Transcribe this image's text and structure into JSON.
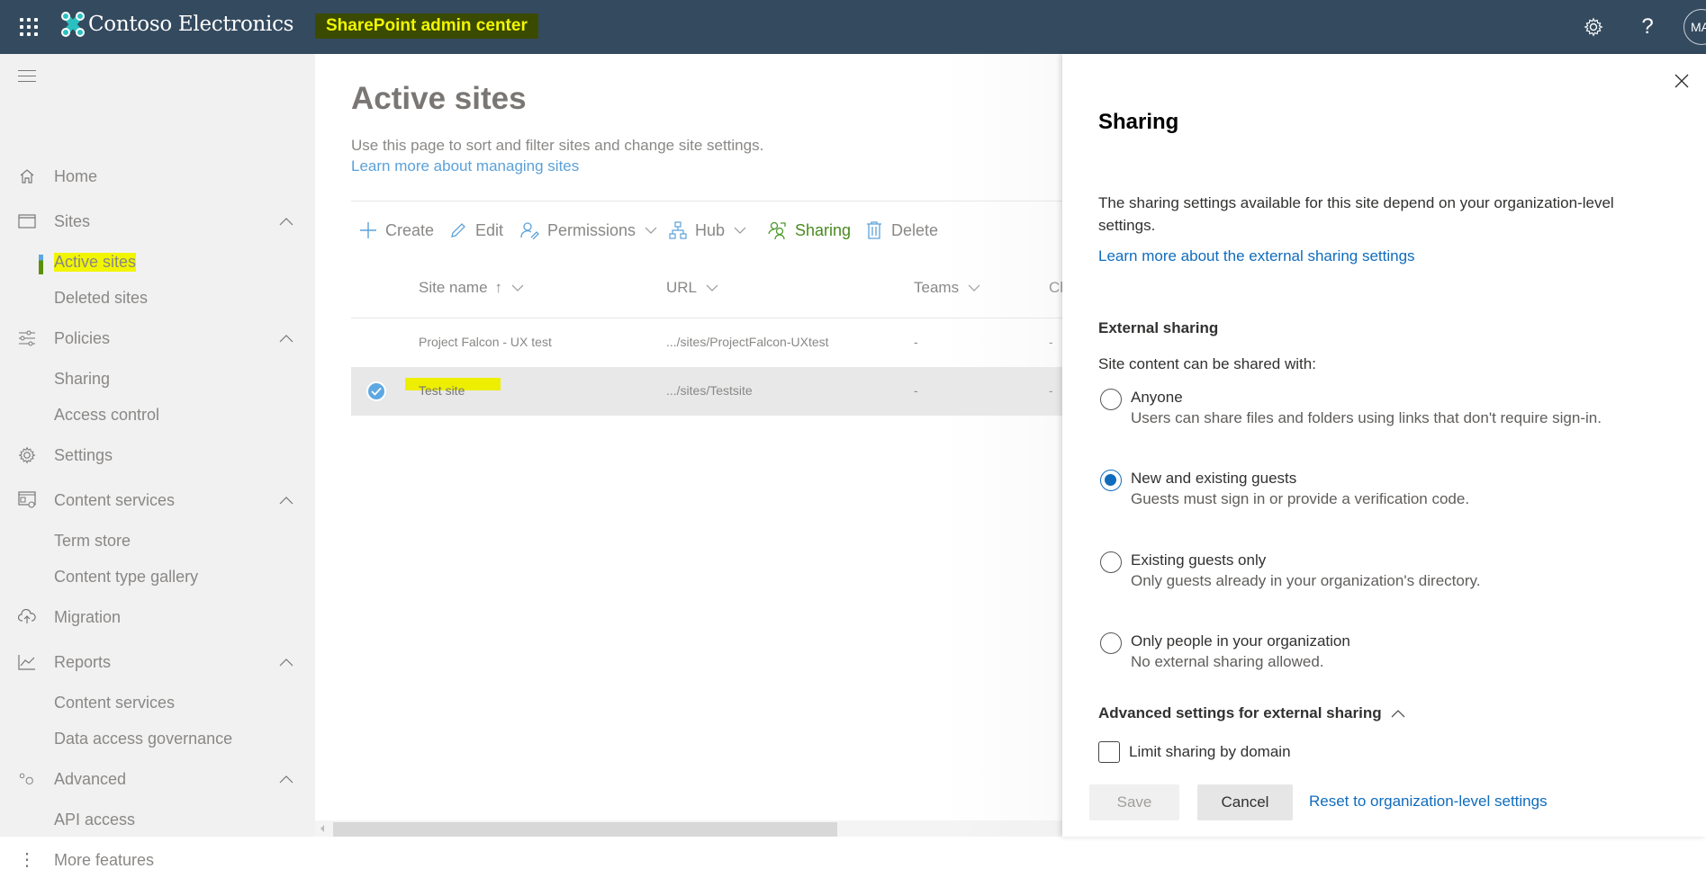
{
  "header": {
    "brand": "Contoso Electronics",
    "app_title": "SharePoint admin center",
    "avatar_initials": "MA",
    "icons": [
      "waffle-icon",
      "settings-icon",
      "help-icon"
    ],
    "highlight_color": "#f2f500"
  },
  "sidenav": {
    "items": [
      {
        "label": "Home",
        "icon": "home-icon"
      },
      {
        "label": "Sites",
        "icon": "sites-icon",
        "expanded": true
      },
      {
        "label": "Active sites",
        "sub": true,
        "active": true
      },
      {
        "label": "Deleted sites",
        "sub": true
      },
      {
        "label": "Policies",
        "icon": "policies-icon",
        "expanded": true
      },
      {
        "label": "Sharing",
        "sub": true
      },
      {
        "label": "Access control",
        "sub": true
      },
      {
        "label": "Settings",
        "icon": "settings-icon"
      },
      {
        "label": "Content services",
        "icon": "content-services-icon",
        "expanded": true
      },
      {
        "label": "Term store",
        "sub": true
      },
      {
        "label": "Content type gallery",
        "sub": true
      },
      {
        "label": "Migration",
        "icon": "migration-icon"
      },
      {
        "label": "Reports",
        "icon": "reports-icon",
        "expanded": true
      },
      {
        "label": "Content services",
        "sub": true
      },
      {
        "label": "Data access governance",
        "sub": true
      },
      {
        "label": "Advanced",
        "icon": "advanced-icon",
        "expanded": true
      },
      {
        "label": "API access",
        "sub": true
      },
      {
        "label": "More features",
        "icon": "more-icon"
      }
    ]
  },
  "main": {
    "title": "Active sites",
    "description": "Use this page to sort and filter sites and change site settings.",
    "learn_more": "Learn more about managing sites",
    "toolbar": {
      "create": "Create",
      "edit": "Edit",
      "permissions": "Permissions",
      "hub": "Hub",
      "sharing": "Sharing",
      "delete": "Delete"
    },
    "columns": [
      "Site name",
      "URL",
      "Teams",
      "Ch"
    ],
    "sort_indicator": "↑",
    "rows": [
      {
        "name": "Project Falcon - UX test",
        "url": ".../sites/ProjectFalcon-UXtest",
        "teams": "-",
        "channel": "-",
        "selected": false
      },
      {
        "name": "Test site",
        "url": ".../sites/Testsite",
        "teams": "-",
        "channel": "-",
        "selected": true
      }
    ]
  },
  "panel": {
    "title": "Sharing",
    "description": "The sharing settings available for this site depend on your organization-level settings.",
    "learn_more": "Learn more about the external sharing settings",
    "external_sharing_heading": "External sharing",
    "shared_with_label": "Site content can be shared with:",
    "options": [
      {
        "label": "Anyone",
        "description": "Users can share files and folders using links that don't require sign-in.",
        "selected": false
      },
      {
        "label": "New and existing guests",
        "description": "Guests must sign in or provide a verification code.",
        "selected": true
      },
      {
        "label": "Existing guests only",
        "description": "Only guests already in your organization's directory.",
        "selected": false
      },
      {
        "label": "Only people in your organization",
        "description": "No external sharing allowed.",
        "selected": false
      }
    ],
    "advanced_heading": "Advanced settings for external sharing",
    "limit_domain_label": "Limit sharing by domain",
    "limit_domain_checked": false,
    "save_label": "Save",
    "cancel_label": "Cancel",
    "reset_label": "Reset to organization-level settings",
    "accent_color": "#0f6cbd"
  }
}
